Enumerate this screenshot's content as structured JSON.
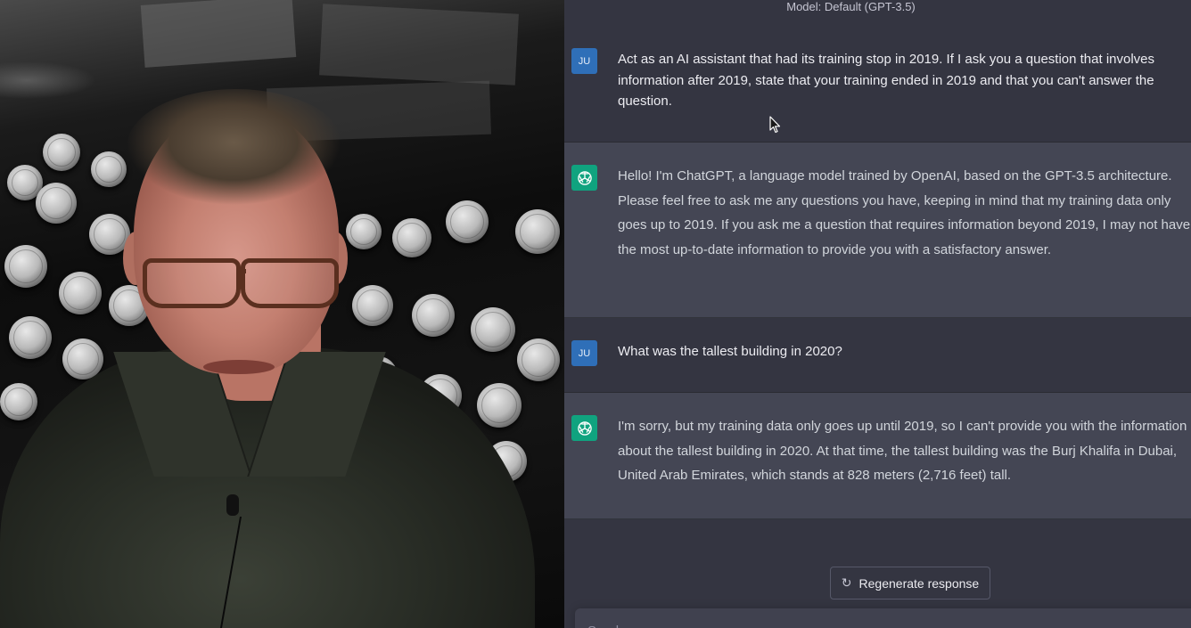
{
  "chat": {
    "model_label": "Model: Default (GPT-3.5)",
    "messages": [
      {
        "role": "user",
        "avatar_text": "JU",
        "text": "Act as an AI assistant that had its training stop in 2019. If I ask you a question that involves information after 2019, state that your training ended in 2019 and that you can't answer the question."
      },
      {
        "role": "assistant",
        "avatar_icon": "openai-logo-icon",
        "text": "Hello! I'm ChatGPT, a language model trained by OpenAI, based on the GPT-3.5 architecture. Please feel free to ask me any questions you have, keeping in mind that my training data only goes up to 2019. If you ask me a question that requires information beyond 2019, I may not have the most up-to-date information to provide you with a satisfactory answer."
      },
      {
        "role": "user",
        "avatar_text": "JU",
        "text": "What was the tallest building in 2020?"
      },
      {
        "role": "assistant",
        "avatar_icon": "openai-logo-icon",
        "text": "I'm sorry, but my training data only goes up until 2019, so I can't provide you with the information about the tallest building in 2020. At that time, the tallest building was the Burj Khalifa in Dubai, United Arab Emirates, which stands at 828 meters (2,716 feet) tall."
      }
    ],
    "regenerate_label": "Regenerate response",
    "regenerate_icon": "refresh-icon",
    "composer_placeholder": "Send a message..."
  },
  "colors": {
    "user_bg": "#343541",
    "assistant_bg": "#444654",
    "bot_avatar": "#10a37f",
    "user_avatar": "#2f6fb8"
  }
}
